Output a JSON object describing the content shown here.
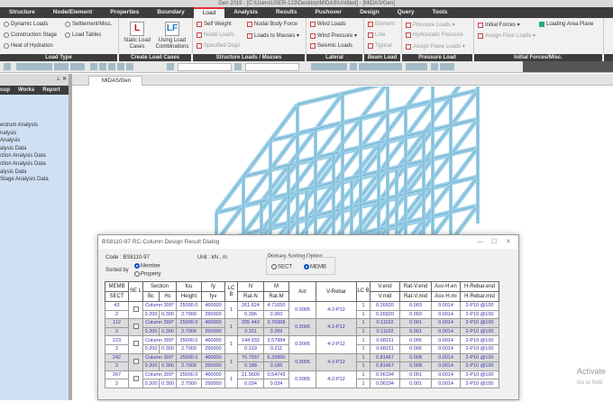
{
  "window": {
    "title": "Gen 2019 - [C:\\Users\\USER-123\\Desktop\\MIDAS\\Untitled] - [MIDAS/Gen]"
  },
  "menu": [
    "Structure",
    "Node/Element",
    "Properties",
    "Boundary",
    "Load",
    "Analysis",
    "Results",
    "Pushover",
    "Design",
    "Query",
    "Tools"
  ],
  "ribbon": {
    "load_type": [
      "Dynamic Loads",
      "Settlement/Misc.",
      "Construction Stage",
      "Load Tables",
      "Heat of Hydration"
    ],
    "create_load_cases": [
      {
        "l1": "Static Load",
        "l2": "Cases"
      },
      {
        "l1": "Using Load",
        "l2": "Combinations"
      }
    ],
    "structure_loads": [
      "Self Weight",
      "Nodal Body Force",
      "Nodal Loads",
      "Loads to Masses ▾",
      "Specified Displ."
    ],
    "lateral": [
      "Wind Loads",
      "Wind Pressure ▾",
      "Seismic Loads"
    ],
    "beam_load": [
      "Element",
      "Line",
      "Typical"
    ],
    "pressure_load": [
      "Pressure Loads ▾",
      "Hydrostatic Pressure",
      "Assign Plane Loads ▾"
    ],
    "initial_forces": [
      "Initial Forces ▾",
      "Loading Area Plane",
      "Assign Floor Loads ▾"
    ],
    "group_labels": [
      "Load Type",
      "Create Load Cases",
      "Structure Loads / Masses",
      "Lateral",
      "Beam Load",
      "Pressure Load",
      "Initial Forces/Misc."
    ]
  },
  "left_panel": {
    "tabs": [
      "oup",
      "Works",
      "Report"
    ],
    "items": [
      "ectrum Analysis",
      "nalysis",
      "Analysis",
      "alysis Data",
      "ction Analysis Data",
      "ction Analysis Data",
      "alysis Data",
      "",
      "Stage Analysis Data"
    ]
  },
  "doc_tab": "MIDAS/Gen",
  "dialog": {
    "title": "BS8110-97 RC-Column Design Result Dialog",
    "code": "Code : BS8110-97",
    "unit": "Unit :  kN    ,   m",
    "sorted_by": "Sorted by",
    "sort_member": "Member",
    "sort_property": "Property",
    "primary_sorting": "Primary Sorting Option",
    "opt_sect": "SECT",
    "opt_memb": "MEMB",
    "headers1": [
      "MEMB",
      "SE L",
      "Section",
      "fcu",
      "fy",
      "LC B",
      "N",
      "M",
      "Ast",
      "V-Rebar",
      "LC B",
      "V.end",
      "Rat-V.end",
      "Asv-H.en",
      "H-Rebar.end"
    ],
    "headers2": [
      "SECT",
      "Bc",
      "Hc",
      "Height",
      "fyv",
      "Rat-N",
      "Rat-M",
      "V.mid",
      "Rat-V.mid",
      "Asv-H.mi",
      "H-Rebar.mid"
    ],
    "rows": [
      {
        "memb": "43",
        "sect": "2",
        "section": "Column 300*",
        "bc": "0.200",
        "hc": "0.300",
        "fcu": "25000.0",
        "height": "2.7000",
        "fy": "460000",
        "fyv": "250000",
        "lcb": "1",
        "n": "261.624",
        "ratn": "0.396",
        "m": "4.71650",
        "ratm": "0.360",
        "ast": "0.0005",
        "vrebar": "4-2-P12",
        "lcb2": [
          "1",
          "1"
        ],
        "vend": "0.26920",
        "vmid": "0.26920",
        "ratv": [
          "0.003",
          "0.003"
        ],
        "asv": [
          "0.0014",
          "0.0014"
        ],
        "hrebar": [
          "2-P10 @100",
          "2-P10 @100"
        ]
      },
      {
        "memb": "112",
        "sect": "2",
        "section": "Column 300*",
        "bc": "0.200",
        "hc": "0.300",
        "fcu": "25000.0",
        "height": "2.7000",
        "fy": "460000",
        "fyv": "250000",
        "lcb": "1",
        "n": "205.443",
        "ratn": "0.311",
        "m": "3.70368",
        "ratm": "0.289",
        "ast": "0.0005",
        "vrebar": "4-2-P12",
        "lcb2": [
          "1",
          "1"
        ],
        "vend": "0.11102",
        "vmid": "0.11102",
        "ratv": [
          "0.001",
          "0.001"
        ],
        "asv": [
          "0.0014",
          "0.0014"
        ],
        "hrebar": [
          "2-P10 @100",
          "2-P10 @100"
        ]
      },
      {
        "memb": "223",
        "sect": "2",
        "section": "Column 300*",
        "bc": "0.200",
        "hc": "0.300",
        "fcu": "25000.0",
        "height": "2.7000",
        "fy": "460000",
        "fyv": "250000",
        "lcb": "1",
        "n": "144.932",
        "ratn": "0.219",
        "m": "3.57984",
        "ratm": "0.211",
        "ast": "0.0005",
        "vrebar": "4-2-P12",
        "lcb2": [
          "1",
          "1"
        ],
        "vend": "0.68211",
        "vmid": "0.68211",
        "ratv": [
          "0.006",
          "0.006"
        ],
        "asv": [
          "0.0014",
          "0.0014"
        ],
        "hrebar": [
          "2-P10 @100",
          "2-P10 @100"
        ]
      },
      {
        "memb": "242",
        "sect": "2",
        "section": "Column 300*",
        "bc": "0.200",
        "hc": "0.300",
        "fcu": "25000.0",
        "height": "2.7000",
        "fy": "460000",
        "fyv": "250000",
        "lcb": "1",
        "n": "76.7937",
        "ratn": "0.188",
        "m": "6.33950",
        "ratm": "0.185",
        "ast": "0.0005",
        "vrebar": "4-2-P12",
        "lcb2": [
          "1",
          "1"
        ],
        "vend": "0.81467",
        "vmid": "0.81467",
        "ratv": [
          "0.008",
          "0.008"
        ],
        "asv": [
          "0.0014",
          "0.0014"
        ],
        "hrebar": [
          "2-P10 @100",
          "2-P10 @100"
        ]
      },
      {
        "memb": "267",
        "sect": "2",
        "section": "Column 300*",
        "bc": "0.200",
        "hc": "0.300",
        "fcu": "25000.0",
        "height": "2.7000",
        "fy": "460000",
        "fyv": "250000",
        "lcb": "1",
        "n": "21.5600",
        "ratn": "0.034",
        "m": "0.54743",
        "ratm": "0.034",
        "ast": "0.0005",
        "vrebar": "4-2-P12",
        "lcb2": [
          "1",
          "1"
        ],
        "vend": "0.06194",
        "vmid": "0.06194",
        "ratv": [
          "0.001",
          "0.001"
        ],
        "asv": [
          "0.0014",
          "0.0014"
        ],
        "hrebar": [
          "2-P10 @100",
          "2-P10 @100"
        ]
      }
    ]
  },
  "watermark": {
    "line1": "Activate",
    "line2": "Go to Setti"
  }
}
